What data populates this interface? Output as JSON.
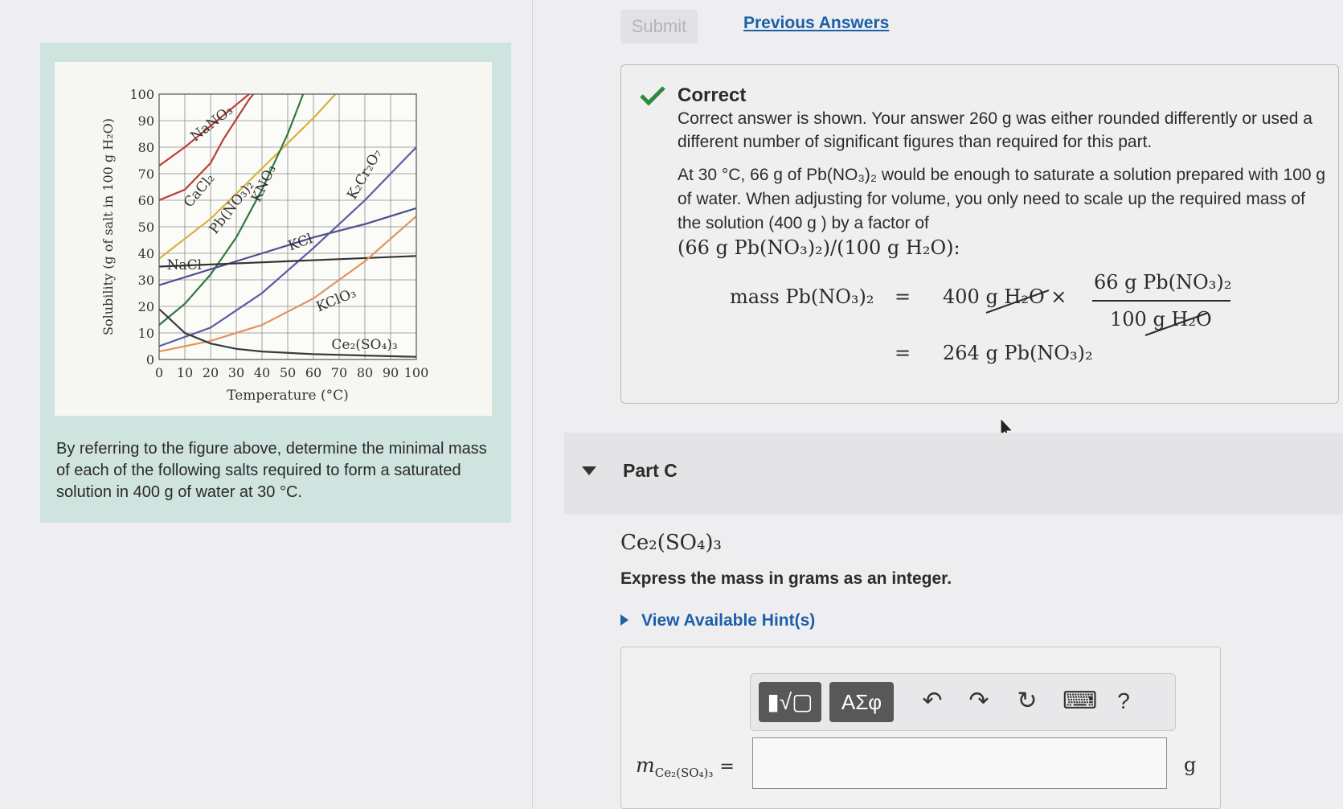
{
  "figure": {
    "chart_data": {
      "type": "line",
      "xlabel": "Temperature (°C)",
      "ylabel": "Solubility (g of salt in 100 g H₂O)",
      "xlim": [
        0,
        100
      ],
      "ylim": [
        0,
        100
      ],
      "xticks": [
        "0",
        "10",
        "20",
        "30",
        "40",
        "50",
        "60",
        "70",
        "80",
        "90",
        "100"
      ],
      "yticks": [
        "0",
        "10",
        "20",
        "30",
        "40",
        "50",
        "60",
        "70",
        "80",
        "90",
        "100"
      ],
      "grid": true,
      "series": [
        {
          "name": "NaNO₃",
          "color": "#c43b3b",
          "x": [
            0,
            10,
            20,
            30,
            40,
            55,
            70
          ],
          "y": [
            73,
            80,
            88,
            96,
            104,
            118,
            133
          ]
        },
        {
          "name": "CaCl₂",
          "color": "#b5423a",
          "x": [
            0,
            10,
            20,
            25,
            35,
            45
          ],
          "y": [
            60,
            64,
            74,
            83,
            98,
            110
          ]
        },
        {
          "name": "Pb(NO₃)₂",
          "color": "#d9b13b",
          "x": [
            0,
            20,
            40,
            60,
            80
          ],
          "y": [
            38,
            53,
            72,
            91,
            112
          ]
        },
        {
          "name": "KNO₃",
          "color": "#2e7a3e",
          "x": [
            0,
            10,
            20,
            30,
            40,
            50,
            60
          ],
          "y": [
            13,
            21,
            32,
            46,
            64,
            85,
            110
          ]
        },
        {
          "name": "KCl",
          "color": "#4b4f8c",
          "x": [
            0,
            20,
            40,
            60,
            80,
            100
          ],
          "y": [
            28,
            34,
            40,
            46,
            51,
            57
          ]
        },
        {
          "name": "K₂Cr₂O₇",
          "color": "#5a5aa6",
          "x": [
            0,
            20,
            40,
            60,
            80,
            100
          ],
          "y": [
            5,
            12,
            25,
            42,
            60,
            80
          ]
        },
        {
          "name": "NaCl",
          "color": "#333333",
          "x": [
            0,
            50,
            100
          ],
          "y": [
            35,
            37,
            39
          ]
        },
        {
          "name": "KClO₃",
          "color": "#e0945a",
          "x": [
            0,
            20,
            40,
            60,
            80,
            100
          ],
          "y": [
            3,
            7,
            13,
            23,
            37,
            54
          ]
        },
        {
          "name": "Ce₂(SO₄)₃",
          "color": "#3a3a3a",
          "x": [
            0,
            10,
            20,
            30,
            40,
            60,
            80,
            100
          ],
          "y": [
            19,
            10,
            6,
            4,
            3,
            2,
            1.5,
            1
          ]
        }
      ]
    },
    "question": "By referring to the figure above, determine the minimal mass of each of the following salts required to form a saturated solution in 400 g of water at 30 °C."
  },
  "actions": {
    "submit_label": "Submit",
    "previous_label": "Previous Answers"
  },
  "feedback": {
    "title": "Correct",
    "line1": "Correct answer is shown. Your answer 260 g was either rounded differently or used a different number of significant figures than required for this part.",
    "line2": "At 30 °C, 66 g of Pb(NO₃)₂ would be enough to saturate a solution prepared with 100 g of water. When adjusting for volume, you only need to scale up the required mass of the solution (400 g ) by a factor of",
    "line3": "(66 g Pb(NO₃)₂)/(100 g H₂O):",
    "eq_lhs": "mass Pb(NO₃)₂",
    "eq_equals1": "=",
    "eq_term": "400 g H₂O ×",
    "eq_num": "66 g Pb(NO₃)₂",
    "eq_den": "100 g H₂O",
    "eq_equals2": "=",
    "eq_result": "264 g Pb(NO₃)₂",
    "accent_color": "#2e8b3d"
  },
  "partc": {
    "title": "Part C",
    "formula": "Ce₂(SO₄)₃",
    "instruction": "Express the mass in grams as an integer.",
    "hint_label": "View Available Hint(s)"
  },
  "answer": {
    "toolbar": {
      "template_button": "▮√▢",
      "symbols_button": "ΑΣφ",
      "undo_icon": "↶",
      "redo_icon": "↷",
      "reset_icon": "↻",
      "keyboard_icon": "⌨",
      "help_icon": "?"
    },
    "label": "m",
    "label_sub": "Ce₂(SO₄)₃",
    "label_eq": "=",
    "value": "",
    "unit": "g"
  }
}
